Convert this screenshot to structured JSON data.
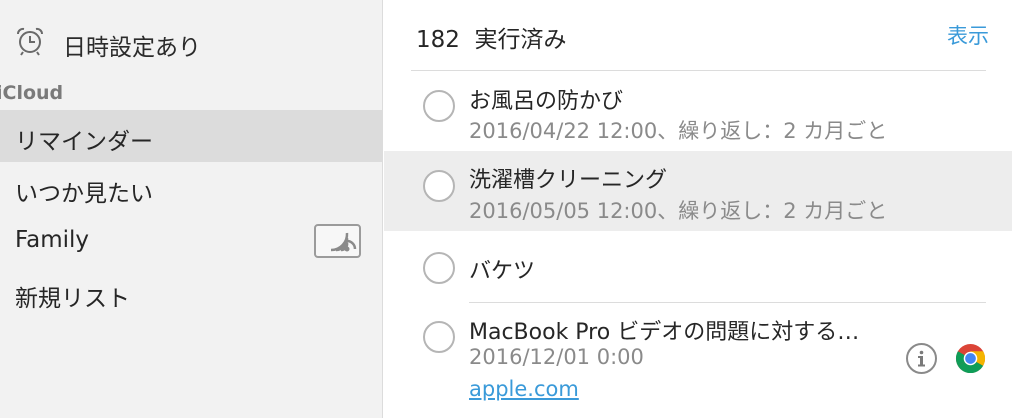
{
  "sidebar": {
    "scheduled": {
      "label": "日時設定あり",
      "icon": "alarm-clock-icon"
    },
    "section": "iCloud",
    "lists": [
      {
        "label": "リマインダー",
        "selected": true
      },
      {
        "label": "いつか見たい",
        "selected": false
      },
      {
        "label": "Family",
        "selected": false,
        "shared": true,
        "icon": "shared-list-icon"
      },
      {
        "label": "新規リスト",
        "selected": false
      }
    ]
  },
  "main": {
    "completed_count": "182",
    "completed_label": "実行済み",
    "show_label": "表示",
    "reminders": [
      {
        "title": "お風呂の防かび",
        "subtitle": "2016/04/22 12:00、繰り返し：2 カ月ごと",
        "highlighted": false
      },
      {
        "title": "洗濯槽クリーニング",
        "subtitle": "2016/05/05 12:00、繰り返し：2 カ月ごと",
        "highlighted": true
      },
      {
        "title": "バケツ",
        "highlighted": false
      },
      {
        "title": "MacBook Pro ビデオの問題に対する…",
        "subtitle": "2016/12/01 0:00",
        "link": "apple.com",
        "highlighted": false,
        "icons": [
          "info-icon",
          "chrome-icon"
        ]
      }
    ]
  },
  "colors": {
    "accent": "#3a9ad9",
    "selection": "#dcdcdc",
    "row_highlight": "#ededed"
  }
}
